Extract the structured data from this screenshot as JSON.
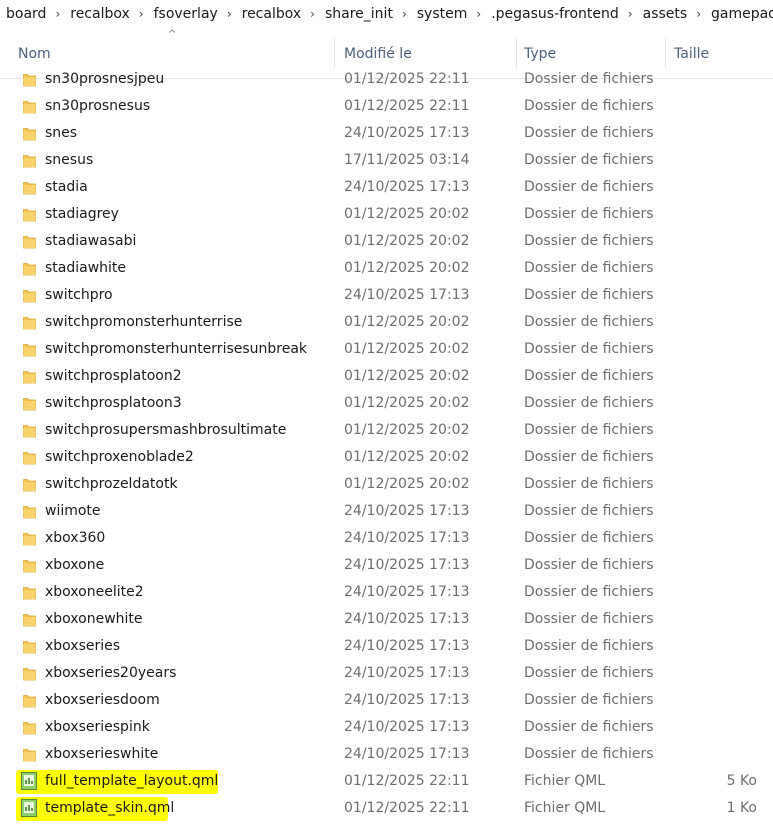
{
  "breadcrumb": [
    "board",
    "recalbox",
    "fsoverlay",
    "recalbox",
    "share_init",
    "system",
    ".pegasus-frontend",
    "assets",
    "gamepad"
  ],
  "breadcrumb_separator": "›",
  "columns": {
    "name": "Nom",
    "modified": "Modifié le",
    "type": "Type",
    "size": "Taille",
    "sort_indicator": "^"
  },
  "colors": {
    "folder": "#f4c34c",
    "highlight": "#ffff00",
    "header_text": "#4c607a"
  },
  "rows": [
    {
      "name": "sn30prosnesjpeu",
      "modified": "01/12/2025 22:11",
      "type": "Dossier de fichiers",
      "size": "",
      "icon": "folder-icon",
      "highlight": false
    },
    {
      "name": "sn30prosnesus",
      "modified": "01/12/2025 22:11",
      "type": "Dossier de fichiers",
      "size": "",
      "icon": "folder-icon",
      "highlight": false
    },
    {
      "name": "snes",
      "modified": "24/10/2025 17:13",
      "type": "Dossier de fichiers",
      "size": "",
      "icon": "folder-icon",
      "highlight": false
    },
    {
      "name": "snesus",
      "modified": "17/11/2025 03:14",
      "type": "Dossier de fichiers",
      "size": "",
      "icon": "folder-icon",
      "highlight": false
    },
    {
      "name": "stadia",
      "modified": "24/10/2025 17:13",
      "type": "Dossier de fichiers",
      "size": "",
      "icon": "folder-icon",
      "highlight": false
    },
    {
      "name": "stadiagrey",
      "modified": "01/12/2025 20:02",
      "type": "Dossier de fichiers",
      "size": "",
      "icon": "folder-icon",
      "highlight": false
    },
    {
      "name": "stadiawasabi",
      "modified": "01/12/2025 20:02",
      "type": "Dossier de fichiers",
      "size": "",
      "icon": "folder-icon",
      "highlight": false
    },
    {
      "name": "stadiawhite",
      "modified": "01/12/2025 20:02",
      "type": "Dossier de fichiers",
      "size": "",
      "icon": "folder-icon",
      "highlight": false
    },
    {
      "name": "switchpro",
      "modified": "24/10/2025 17:13",
      "type": "Dossier de fichiers",
      "size": "",
      "icon": "folder-icon",
      "highlight": false
    },
    {
      "name": "switchpromonsterhunterrise",
      "modified": "01/12/2025 20:02",
      "type": "Dossier de fichiers",
      "size": "",
      "icon": "folder-icon",
      "highlight": false
    },
    {
      "name": "switchpromonsterhunterrisesunbreak",
      "modified": "01/12/2025 20:02",
      "type": "Dossier de fichiers",
      "size": "",
      "icon": "folder-icon",
      "highlight": false
    },
    {
      "name": "switchprosplatoon2",
      "modified": "01/12/2025 20:02",
      "type": "Dossier de fichiers",
      "size": "",
      "icon": "folder-icon",
      "highlight": false
    },
    {
      "name": "switchprosplatoon3",
      "modified": "01/12/2025 20:02",
      "type": "Dossier de fichiers",
      "size": "",
      "icon": "folder-icon",
      "highlight": false
    },
    {
      "name": "switchprosupersmashbrosultimate",
      "modified": "01/12/2025 20:02",
      "type": "Dossier de fichiers",
      "size": "",
      "icon": "folder-icon",
      "highlight": false
    },
    {
      "name": "switchproxenoblade2",
      "modified": "01/12/2025 20:02",
      "type": "Dossier de fichiers",
      "size": "",
      "icon": "folder-icon",
      "highlight": false
    },
    {
      "name": "switchprozeldatotk",
      "modified": "01/12/2025 20:02",
      "type": "Dossier de fichiers",
      "size": "",
      "icon": "folder-icon",
      "highlight": false
    },
    {
      "name": "wiimote",
      "modified": "24/10/2025 17:13",
      "type": "Dossier de fichiers",
      "size": "",
      "icon": "folder-icon",
      "highlight": false
    },
    {
      "name": "xbox360",
      "modified": "24/10/2025 17:13",
      "type": "Dossier de fichiers",
      "size": "",
      "icon": "folder-icon",
      "highlight": false
    },
    {
      "name": "xboxone",
      "modified": "24/10/2025 17:13",
      "type": "Dossier de fichiers",
      "size": "",
      "icon": "folder-icon",
      "highlight": false
    },
    {
      "name": "xboxoneelite2",
      "modified": "24/10/2025 17:13",
      "type": "Dossier de fichiers",
      "size": "",
      "icon": "folder-icon",
      "highlight": false
    },
    {
      "name": "xboxonewhite",
      "modified": "24/10/2025 17:13",
      "type": "Dossier de fichiers",
      "size": "",
      "icon": "folder-icon",
      "highlight": false
    },
    {
      "name": "xboxseries",
      "modified": "24/10/2025 17:13",
      "type": "Dossier de fichiers",
      "size": "",
      "icon": "folder-icon",
      "highlight": false
    },
    {
      "name": "xboxseries20years",
      "modified": "24/10/2025 17:13",
      "type": "Dossier de fichiers",
      "size": "",
      "icon": "folder-icon",
      "highlight": false
    },
    {
      "name": "xboxseriesdoom",
      "modified": "24/10/2025 17:13",
      "type": "Dossier de fichiers",
      "size": "",
      "icon": "folder-icon",
      "highlight": false
    },
    {
      "name": "xboxseriespink",
      "modified": "24/10/2025 17:13",
      "type": "Dossier de fichiers",
      "size": "",
      "icon": "folder-icon",
      "highlight": false
    },
    {
      "name": "xboxserieswhite",
      "modified": "24/10/2025 17:13",
      "type": "Dossier de fichiers",
      "size": "",
      "icon": "folder-icon",
      "highlight": false
    },
    {
      "name": "full_template_layout.qml",
      "modified": "01/12/2025 22:11",
      "type": "Fichier QML",
      "size": "5 Ko",
      "icon": "qml-file-icon",
      "highlight": true
    },
    {
      "name": "template_skin.qml",
      "modified": "01/12/2025 22:11",
      "type": "Fichier QML",
      "size": "1 Ko",
      "icon": "qml-file-icon",
      "highlight": true
    }
  ]
}
